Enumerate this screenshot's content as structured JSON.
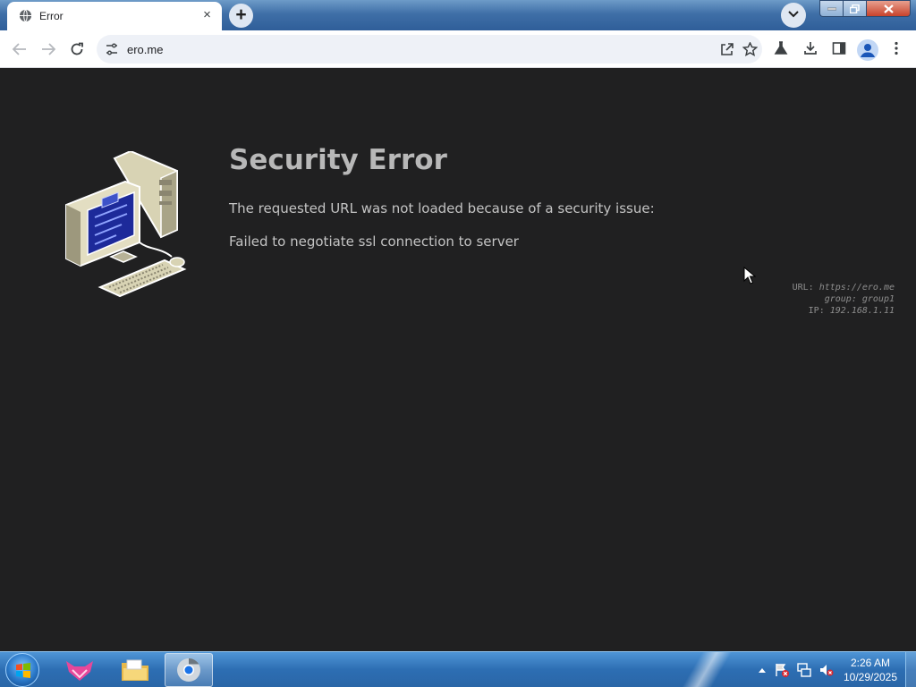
{
  "browser": {
    "tab": {
      "title": "Error",
      "favicon": "globe-icon"
    },
    "new_tab_symbol": "+",
    "address": "ero.me",
    "toolbar_icons": [
      "share-icon",
      "star-icon",
      "labs-icon",
      "download-icon",
      "side-panel-icon",
      "profile-icon",
      "menu-icon"
    ]
  },
  "page": {
    "title": "Security Error",
    "message": "The requested URL was not loaded because of a security issue:",
    "reason": "Failed to negotiate ssl connection to server",
    "info": {
      "url_label": "URL:",
      "url_value": "https://ero.me",
      "group_label": "group:",
      "group_value": "group1",
      "ip_label": "IP:",
      "ip_value": "192.168.1.11"
    }
  },
  "taskbar": {
    "apps": [
      "start-orb-icon",
      "fox-app-icon",
      "file-explorer-icon",
      "chrome-icon"
    ],
    "clock_time": "2:26 AM",
    "clock_date": "10/29/2025"
  },
  "colors": {
    "page_background": "#202021",
    "title_text": "#b8b8b8",
    "body_text": "#c4c4c4",
    "taskbar": "#2d6eb3"
  }
}
